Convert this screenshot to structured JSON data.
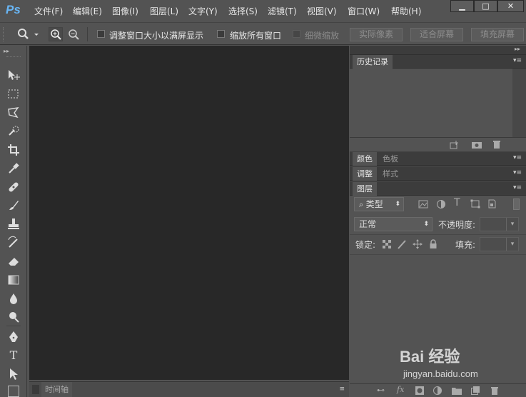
{
  "app": {
    "logo": "Ps"
  },
  "menu": [
    "文件(F)",
    "编辑(E)",
    "图像(I)",
    "图层(L)",
    "文字(Y)",
    "选择(S)",
    "滤镜(T)",
    "视图(V)",
    "窗口(W)",
    "帮助(H)"
  ],
  "window_buttons": {
    "minimize": "▁",
    "maximize": "□",
    "close": "✕"
  },
  "options": {
    "resize_windows": "调整窗口大小以满屏显示",
    "zoom_all_windows": "缩放所有窗口",
    "scrubby_zoom": "细微缩放",
    "actual_pixels": "实际像素",
    "fit_screen": "适合屏幕",
    "fill_screen": "填充屏幕"
  },
  "timeline_label": "时间轴",
  "panels": {
    "history": {
      "tab": "历史记录"
    },
    "color_group": {
      "tabs": [
        "颜色",
        "色板"
      ]
    },
    "adjust_group": {
      "tabs": [
        "调整",
        "样式"
      ]
    },
    "layers": {
      "tab": "图层",
      "filter_kind": "类型",
      "blend_mode": "正常",
      "opacity_label": "不透明度:",
      "lock_label": "锁定:",
      "fill_label": "填充:"
    }
  },
  "watermark": {
    "brand": "Bai 经验",
    "url": "jingyan.baidu.com"
  },
  "colors": {
    "canvas": "#282828",
    "chrome": "#535353",
    "panel": "#424242",
    "ps_blue": "#69b5f3"
  }
}
